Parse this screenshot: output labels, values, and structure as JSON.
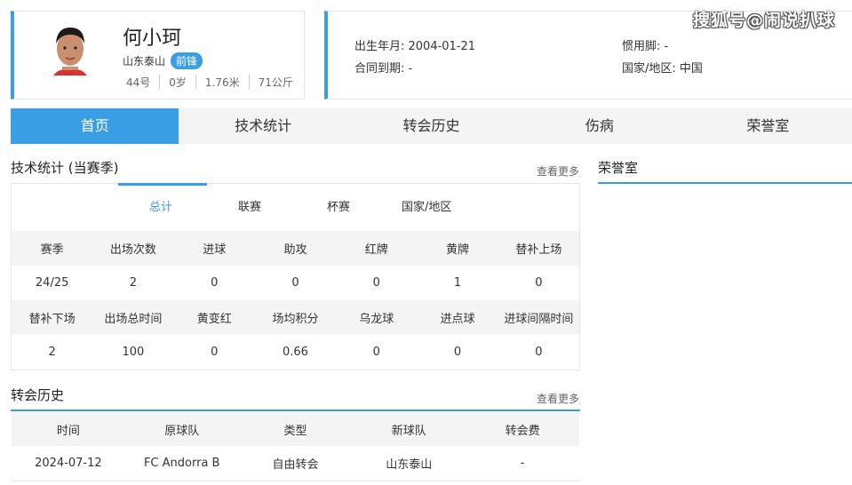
{
  "watermark": "搜狐号@闹说扒球",
  "profile": {
    "name": "何小珂",
    "team": "山东泰山",
    "position": "前锋",
    "number": "44号",
    "age": "0岁",
    "height": "1.76米",
    "weight": "71公斤"
  },
  "info": {
    "birth": "出生年月: 2004-01-21",
    "contract": "合同到期: -",
    "foot": "惯用脚: -",
    "nation": "国家/地区: 中国"
  },
  "tabs": [
    "首页",
    "技术统计",
    "转会历史",
    "伤病",
    "荣誉室"
  ],
  "stats_section": {
    "title": "技术统计 (当赛季)",
    "more": "查看更多",
    "sub_tabs": [
      "总计",
      "联赛",
      "杯赛",
      "国家/地区"
    ],
    "header1": [
      "赛季",
      "出场次数",
      "进球",
      "助攻",
      "红牌",
      "黄牌",
      "替补上场"
    ],
    "row1": [
      "24/25",
      "2",
      "0",
      "0",
      "0",
      "1",
      "0"
    ],
    "header2": [
      "替补下场",
      "出场总时间",
      "黄变红",
      "场均积分",
      "乌龙球",
      "进点球",
      "进球间隔时间"
    ],
    "row2": [
      "2",
      "100",
      "0",
      "0.66",
      "0",
      "0",
      "0"
    ]
  },
  "honor_section": {
    "title": "荣誉室"
  },
  "transfer_section": {
    "title": "转会历史",
    "more": "查看更多",
    "headers": [
      "时间",
      "原球队",
      "类型",
      "新球队",
      "转会费"
    ],
    "row": [
      "2024-07-12",
      "FC Andorra B",
      "自由转会",
      "山东泰山",
      "-"
    ]
  },
  "colors": {
    "accent": "#3a9ee4",
    "header_bg": "#f4f4f4"
  }
}
